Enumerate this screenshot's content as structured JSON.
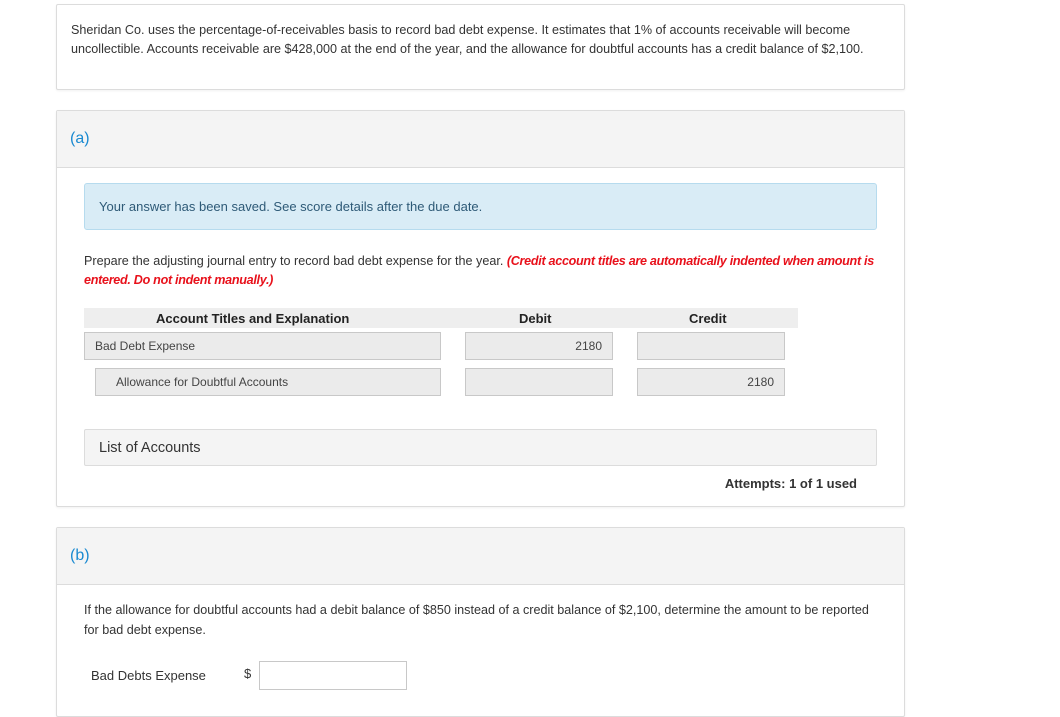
{
  "intro": {
    "text": "Sheridan Co. uses the percentage-of-receivables basis to record bad debt expense. It estimates that 1% of accounts receivable will become uncollectible. Accounts receivable are $428,000 at the end of the year, and the allowance for doubtful accounts has a credit balance of $2,100."
  },
  "part_a": {
    "label": "(a)",
    "alert": "Your answer has been saved. See score details after the due date.",
    "instruction": "Prepare the adjusting journal entry to record bad debt expense for the year.",
    "instruction_note": "(Credit account titles are automatically indented when amount is entered. Do not indent manually.)",
    "table": {
      "headers": [
        "Account Titles and Explanation",
        "Debit",
        "Credit"
      ],
      "rows": [
        {
          "account": "Bad Debt Expense",
          "debit": "2180",
          "credit": ""
        },
        {
          "account": "Allowance for Doubtful Accounts",
          "debit": "",
          "credit": "2180"
        }
      ]
    },
    "list_of_accounts": "List of Accounts",
    "attempts": "Attempts: 1 of 1 used"
  },
  "part_b": {
    "label": "(b)",
    "question": "If the allowance for doubtful accounts had a debit balance of $850 instead of a credit balance of $2,100, determine the amount to be reported for bad debt expense.",
    "field_label": "Bad Debts Expense",
    "currency": "$",
    "field_value": ""
  },
  "colors": {
    "part_label": "#1a8ad1",
    "alert_bg": "#d9ecf6",
    "note_red": "#e8111b"
  }
}
